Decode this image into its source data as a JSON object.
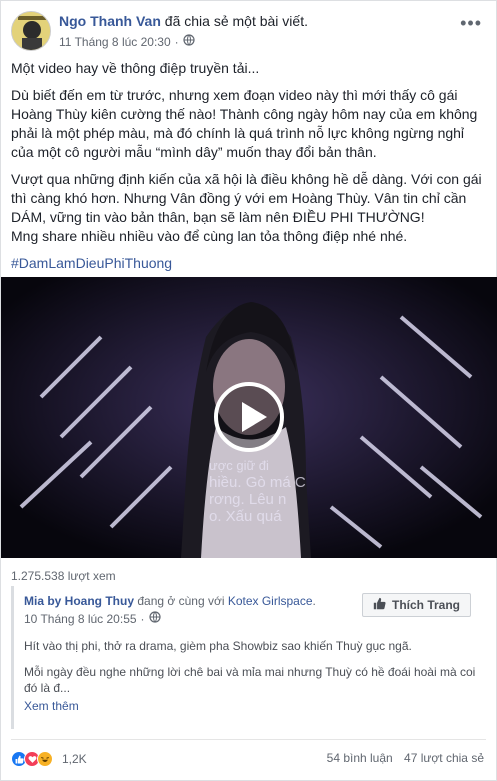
{
  "post": {
    "author": "Ngo Thanh Van",
    "action": "đã chia sẻ một bài viết.",
    "timestamp": "11 Tháng 8 lúc 20:30",
    "separator": "·",
    "paragraphs": [
      "Một video hay về thông điệp truyền tải...",
      "Dù biết đến em từ trước, nhưng xem đoạn video này thì mới thấy cô gái Hoàng Thùy kiên cường thế nào! Thành công ngày hôm nay của em không phải là một phép màu, mà đó chính là quá trình nỗ lực không ngừng nghỉ của một cô người mẫu “mình dây” muốn thay đổi bản thân.",
      "Vượt qua những định kiến của xã hội là điều không hề dễ dàng. Với con gái thì càng khó hơn. Nhưng Vân đồng ý với em Hoàng Thùy. Vân tin chỉ cần DÁM, vững tin vào bản thân, bạn sẽ làm nên ĐIỀU PHI THƯỜNG!\nMng share nhiều nhiều vào để cùng lan tỏa thông điệp nhé nhé."
    ],
    "hashtag": "#DamLamDieuPhiThuong",
    "video_overlay_text": [
      "ược giữ đi",
      "hiều. Gò má C",
      "rơng. Lêu n",
      "o. Xấu quá"
    ],
    "views": "1.275.538 lượt xem"
  },
  "shared": {
    "author": "Mia by Hoang Thuy",
    "with_text": "đang ở cùng với",
    "with_page": "Kotex Girlspace",
    "end_dot": ".",
    "timestamp": "10 Tháng 8 lúc 20:55",
    "separator": "·",
    "like_button": "Thích Trang",
    "paragraph1": "Hít vào thị phi, thở ra drama, gièm pha Showbiz sao khiến Thuỳ gục ngã.",
    "paragraph2": "Mỗi ngày đều nghe những lời chê bai và mỉa mai nhưng Thuỳ có hề đoái hoài mà coi đó là đ...",
    "see_more": "Xem thêm"
  },
  "footer": {
    "reaction_count": "1,2K",
    "comments": "54 bình luận",
    "shares": "47 lượt chia sẻ"
  },
  "icons": {
    "globe": "globe-icon",
    "like": "like-reaction-icon",
    "love": "love-reaction-icon",
    "haha": "haha-reaction-icon",
    "more": "more-options-icon",
    "thumb": "thumbs-up-icon",
    "play": "play-icon"
  },
  "colors": {
    "link_blue": "#385898",
    "like_blue": "#1877f2",
    "love_red": "#f33e58",
    "haha_yellow": "#f7b125"
  }
}
